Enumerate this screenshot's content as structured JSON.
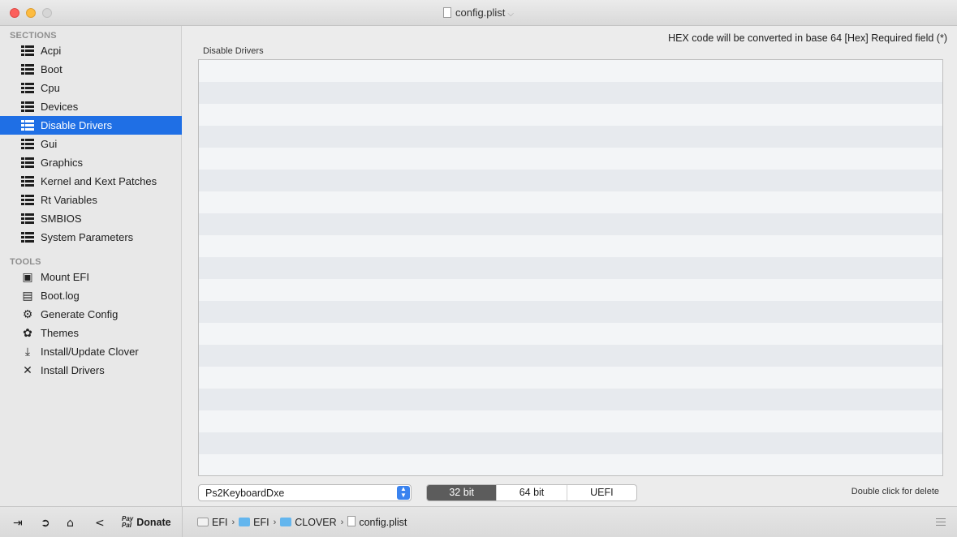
{
  "window": {
    "title": "config.plist"
  },
  "sidebar": {
    "sections_header": "SECTIONS",
    "sections": [
      {
        "label": "Acpi",
        "icon": "list-icon",
        "selected": false
      },
      {
        "label": "Boot",
        "icon": "list-icon",
        "selected": false
      },
      {
        "label": "Cpu",
        "icon": "list-icon",
        "selected": false
      },
      {
        "label": "Devices",
        "icon": "list-icon",
        "selected": false
      },
      {
        "label": "Disable Drivers",
        "icon": "list-icon",
        "selected": true
      },
      {
        "label": "Gui",
        "icon": "list-icon",
        "selected": false
      },
      {
        "label": "Graphics",
        "icon": "list-icon",
        "selected": false
      },
      {
        "label": "Kernel and Kext Patches",
        "icon": "list-icon",
        "selected": false
      },
      {
        "label": "Rt Variables",
        "icon": "list-icon",
        "selected": false
      },
      {
        "label": "SMBIOS",
        "icon": "list-icon",
        "selected": false
      },
      {
        "label": "System Parameters",
        "icon": "list-icon",
        "selected": false
      }
    ],
    "tools_header": "TOOLS",
    "tools": [
      {
        "label": "Mount EFI",
        "icon": "mount-efi-icon"
      },
      {
        "label": "Boot.log",
        "icon": "boot-log-icon"
      },
      {
        "label": "Generate Config",
        "icon": "gears-icon"
      },
      {
        "label": "Themes",
        "icon": "palette-icon"
      },
      {
        "label": "Install/Update Clover",
        "icon": "download-icon"
      },
      {
        "label": "Install Drivers",
        "icon": "tools-icon"
      }
    ]
  },
  "main": {
    "hex_note": "HEX code will be converted in base 64 [Hex]   Required field (*)",
    "panel_label": "Disable Drivers",
    "driver_combo_value": "Ps2KeyboardDxe",
    "segments": [
      {
        "label": "32 bit",
        "active": true
      },
      {
        "label": "64 bit",
        "active": false
      },
      {
        "label": "UEFI",
        "active": false
      }
    ],
    "double_click_hint": "Double click for delete"
  },
  "bottombar": {
    "donate_label": "Donate",
    "paypal_line1": "Pay",
    "paypal_line2": "Pal",
    "path": [
      "EFI",
      "EFI",
      "CLOVER",
      "config.plist"
    ]
  },
  "colors": {
    "selection": "#1f6fe5",
    "segment_active": "#5c5c5c",
    "folder": "#64b6ee"
  }
}
